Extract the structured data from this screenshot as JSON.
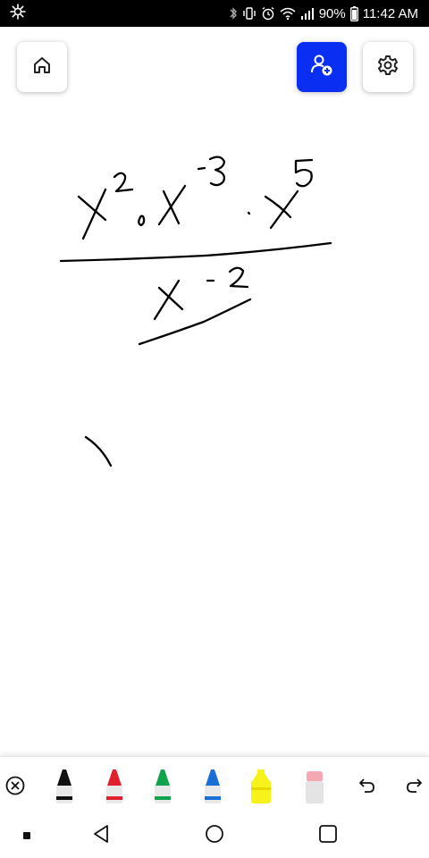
{
  "status_bar": {
    "battery": "90%",
    "time": "11:42 AM",
    "icons": [
      "app-notification-icon",
      "bluetooth-icon",
      "vibrate-icon",
      "alarm-icon",
      "wifi-icon",
      "signal-icon"
    ]
  },
  "top_bar": {
    "buttons": [
      "home-icon",
      "add-user-icon",
      "gear-icon"
    ],
    "accent_color": "#0a2ff3"
  },
  "toolbar": {
    "tools": [
      {
        "name": "close",
        "icon": "close-circle-icon"
      },
      {
        "name": "black-marker",
        "color": "#111111"
      },
      {
        "name": "red-marker",
        "color": "#e0202a"
      },
      {
        "name": "green-marker",
        "color": "#11a34a"
      },
      {
        "name": "blue-marker",
        "color": "#1a6fd6"
      },
      {
        "name": "highlighter",
        "color": "#f7f21a"
      },
      {
        "name": "eraser",
        "color": "#f4a8b2"
      },
      {
        "name": "undo",
        "icon": "undo-icon"
      },
      {
        "name": "redo",
        "icon": "redo-icon"
      }
    ]
  },
  "nav_bar": {
    "icons": [
      "recents-dot-icon",
      "back-icon",
      "home-circle-icon",
      "overview-square-icon"
    ]
  }
}
